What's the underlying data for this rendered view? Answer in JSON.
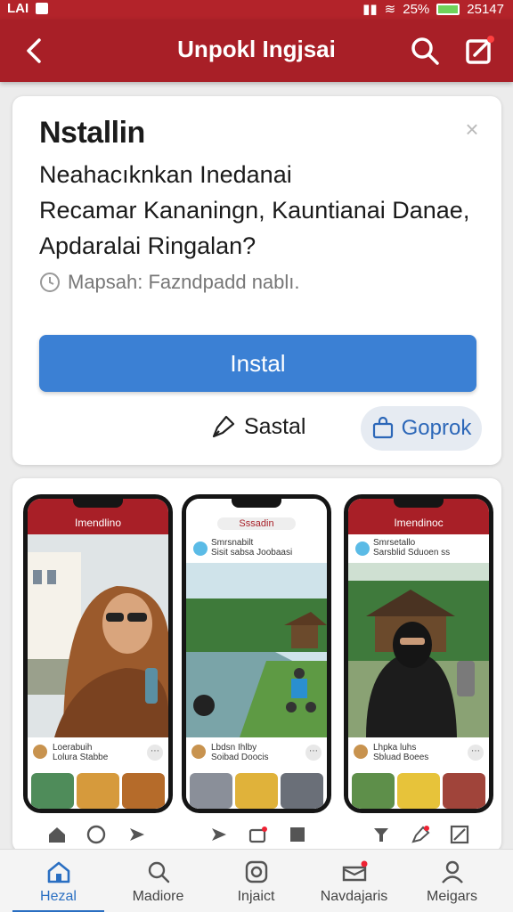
{
  "status_bar": {
    "carrier": "LAI",
    "battery": "25%",
    "time": "25147"
  },
  "app_bar": {
    "title": "Unpokl Ingjsai"
  },
  "install_card": {
    "title": "Nstallin",
    "description_lines": [
      "Neahacıknkan Inedanai",
      "Recamar Kananingn, Kauntianai Danae,",
      "Apdaralai Ringalan?"
    ],
    "meta": "Mapsah: Fazndpadd nablı.",
    "install_label": "Instal",
    "sastal_label": "Sastal",
    "goprok_label": "Goprok"
  },
  "preview": {
    "phones": [
      {
        "header": "Imendlino",
        "footer_name": "Loerabuih",
        "footer_sub": "Lolura Stabbe"
      },
      {
        "header": "Sssadin",
        "post_name": "Smrsnabilt",
        "post_sub": "Sisit sabsa Joobaasi",
        "footer_name": "Lbdsn Ihlby",
        "footer_sub": "Soibad Doocis"
      },
      {
        "header": "Imendinoc",
        "post_name": "Smrsetallo",
        "post_sub": "Sarsblid Sduoen ss",
        "footer_name": "Lhpka luhs",
        "footer_sub": "Sbluad Boees"
      }
    ]
  },
  "bottom_nav": {
    "items": [
      {
        "label": "Hezal",
        "icon": "home-icon",
        "active": true
      },
      {
        "label": "Madiore",
        "icon": "search-icon",
        "active": false
      },
      {
        "label": "Injaict",
        "icon": "instagram-icon",
        "active": false
      },
      {
        "label": "Navdajaris",
        "icon": "inbox-icon",
        "active": false
      },
      {
        "label": "Meigars",
        "icon": "profile-icon",
        "active": false
      }
    ]
  },
  "colors": {
    "brand_red": "#a81f27",
    "primary_blue": "#3b80d4",
    "active_nav": "#2a6fc2"
  }
}
